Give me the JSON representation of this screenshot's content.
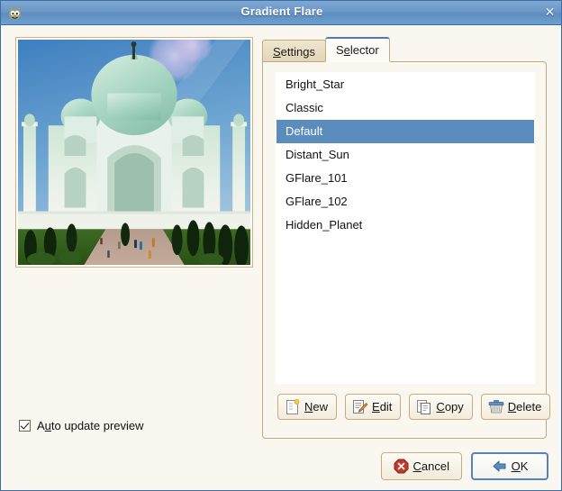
{
  "window": {
    "title": "Gradient Flare",
    "icon": "gimp-wilber-icon",
    "close_label": "✕",
    "accent_titlebar": "#6b98c8",
    "background": "#faf7f0",
    "selection_color": "#5b8cbe"
  },
  "preview": {
    "name": "gradient-flare-preview",
    "description": "Taj Mahal photograph with gradient flare effect applied",
    "auto_update": {
      "label_pre": "A",
      "label_accel": "u",
      "label_post": "to update preview",
      "label": "Auto update preview",
      "checked": true
    }
  },
  "notebook": {
    "tabs": [
      {
        "name": "tab-settings",
        "label": "Settings",
        "accel": "S",
        "pre": "",
        "post": "ettings",
        "active": false
      },
      {
        "name": "tab-selector",
        "label": "Selector",
        "accel": "e",
        "pre": "S",
        "post": "lector",
        "active": true
      }
    ]
  },
  "selector": {
    "items": [
      {
        "label": "Bright_Star",
        "selected": false
      },
      {
        "label": "Classic",
        "selected": false
      },
      {
        "label": "Default",
        "selected": true
      },
      {
        "label": "Distant_Sun",
        "selected": false
      },
      {
        "label": "GFlare_101",
        "selected": false
      },
      {
        "label": "GFlare_102",
        "selected": false
      },
      {
        "label": "Hidden_Planet",
        "selected": false
      }
    ],
    "buttons": [
      {
        "name": "new-button",
        "label": "New",
        "pre": "",
        "accel": "N",
        "post": "ew",
        "icon": "new-document-icon"
      },
      {
        "name": "edit-button",
        "label": "Edit",
        "pre": "",
        "accel": "E",
        "post": "dit",
        "icon": "edit-pencil-icon"
      },
      {
        "name": "copy-button",
        "label": "Copy",
        "pre": "",
        "accel": "C",
        "post": "opy",
        "icon": "copy-pages-icon"
      },
      {
        "name": "delete-button",
        "label": "Delete",
        "pre": "",
        "accel": "D",
        "post": "elete",
        "icon": "trash-can-icon"
      }
    ]
  },
  "dialog_buttons": [
    {
      "name": "cancel-button",
      "label": "Cancel",
      "pre": "",
      "accel": "C",
      "post": "ancel",
      "icon": "cancel-stop-icon",
      "default": false
    },
    {
      "name": "ok-button",
      "label": "OK",
      "pre": "",
      "accel": "O",
      "post": "K",
      "icon": "enter-arrow-icon",
      "default": true
    }
  ]
}
